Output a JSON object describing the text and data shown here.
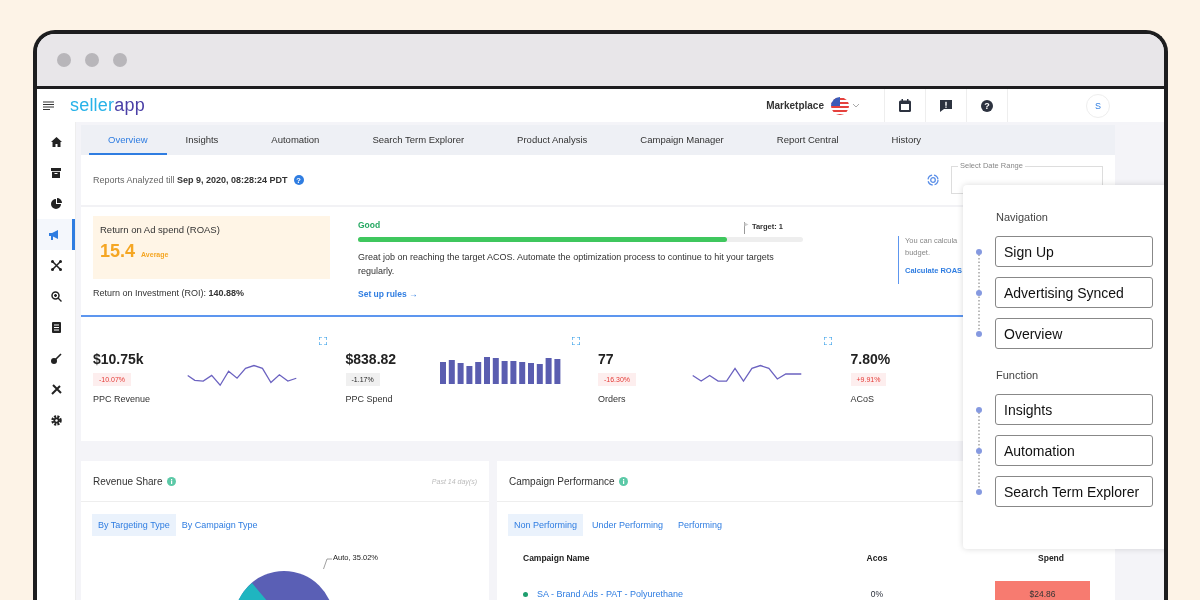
{
  "topbar": {
    "logo": {
      "part_1": "seller",
      "part_2": "app"
    },
    "marketplace": "Marketplace",
    "help": "?",
    "avatar": "S"
  },
  "sidebar": {
    "items": [
      {
        "selected": false
      },
      {
        "selected": false
      },
      {
        "selected": false
      },
      {
        "selected": true
      },
      {
        "selected": false
      },
      {
        "selected": false
      },
      {
        "selected": false
      },
      {
        "selected": false
      },
      {
        "selected": false
      },
      {
        "selected": false
      }
    ]
  },
  "tabs": [
    {
      "label": "Overview",
      "selected": true
    },
    {
      "label": "Insights",
      "selected": false
    },
    {
      "label": "Automation",
      "selected": false
    },
    {
      "label": "Search Term Explorer",
      "selected": false
    },
    {
      "label": "Product Analysis",
      "selected": false
    },
    {
      "label": "Campaign Manager",
      "selected": false
    },
    {
      "label": "Report Central",
      "selected": false
    },
    {
      "label": "History",
      "selected": false
    }
  ],
  "report": {
    "text": "Reports Analyzed till **Sep 9, 2020, 08:28:24 PDT**",
    "help": "?",
    "date_range_label": "Select Date Range"
  },
  "roas": {
    "title": "Return on Ad spend (ROAS)",
    "value": "15.4",
    "rating": "Average",
    "roi": "Return on Investment (ROI): **140.88%**"
  },
  "goal": {
    "status": "Good",
    "level": 0.83,
    "target": "Target: 1",
    "message": "Great job on reaching the target ACOS. Automate the optimization process to continue to hit your targets regularly.",
    "link": "Set up rules →"
  },
  "note": {
    "lines": [
      "You can calcula",
      "budget."
    ],
    "link": "Calculate ROAS"
  },
  "metrics": [
    {
      "value": "$10.75k",
      "change": "-10.07%",
      "kind": "negative",
      "label": "PPC Revenue"
    },
    {
      "value": "$838.82",
      "change": "-1.17%",
      "kind": "neutral",
      "label": "PPC Spend"
    },
    {
      "value": "77",
      "change": "-16.30%",
      "kind": "negative",
      "label": "Orders"
    },
    {
      "value": "7.80%",
      "change": "+9.91%",
      "kind": "negative",
      "label": "ACoS"
    }
  ],
  "revenue_share": {
    "title": "Revenue Share",
    "period": "Past 14 day(s)",
    "tabs": [
      {
        "label": "By Targeting Type",
        "selected": true
      },
      {
        "label": "By Campaign Type",
        "selected": false
      }
    ],
    "pie_label": "Auto, 35.02%"
  },
  "campaign_performance": {
    "title": "Campaign Performance",
    "tabs": [
      {
        "label": "Non Performing",
        "selected": true
      },
      {
        "label": "Under Performing",
        "selected": false
      },
      {
        "label": "Performing",
        "selected": false
      }
    ],
    "columns": [
      "Campaign Name",
      "Acos",
      "Spend"
    ],
    "rows": [
      {
        "name": "SA - Brand Ads - PAT - Polyurethane",
        "color": "#1e9e6e",
        "acos": "0%",
        "spend": "$24.86"
      }
    ]
  },
  "guide": {
    "sections": [
      {
        "title": "Navigation",
        "items": [
          "Sign Up",
          "Advertising Synced",
          "Overview"
        ]
      },
      {
        "title": "Function",
        "items": [
          "Insights",
          "Automation",
          "Search Term Explorer"
        ]
      }
    ]
  }
}
